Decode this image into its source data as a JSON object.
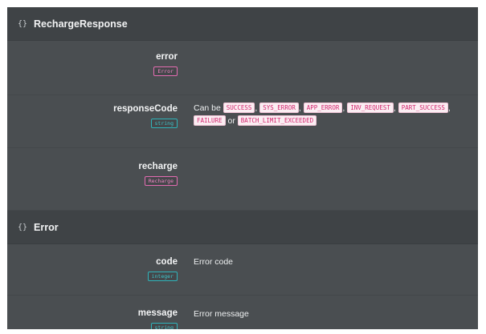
{
  "recharge_response": {
    "icon": "braces-icon",
    "title": "RechargeResponse",
    "fields": {
      "error": {
        "name": "error",
        "type": "Error"
      },
      "response_code": {
        "name": "responseCode",
        "type": "string",
        "desc_prefix": "Can be",
        "values": [
          "SUCCESS",
          "SYS_ERROR",
          "APP_ERROR",
          "INV_REQUEST",
          "PART_SUCCESS",
          "FAILURE",
          "BATCH_LIMIT_EXCEEDED"
        ],
        "sep": ",",
        "or": "or"
      },
      "recharge": {
        "name": "recharge",
        "type": "Recharge"
      }
    }
  },
  "error_model": {
    "icon": "braces-icon",
    "title": "Error",
    "fields": {
      "code": {
        "name": "code",
        "type": "integer",
        "description": "Error code"
      },
      "message": {
        "name": "message",
        "type": "string",
        "description": "Error message"
      }
    }
  },
  "colors": {
    "background": "#4a4e51",
    "header": "#3f4346",
    "link_type": "#ef86c4",
    "primitive_type": "#3cc6cc",
    "code_chip_text": "#d2246c",
    "code_chip_bg": "#fbeef3"
  }
}
